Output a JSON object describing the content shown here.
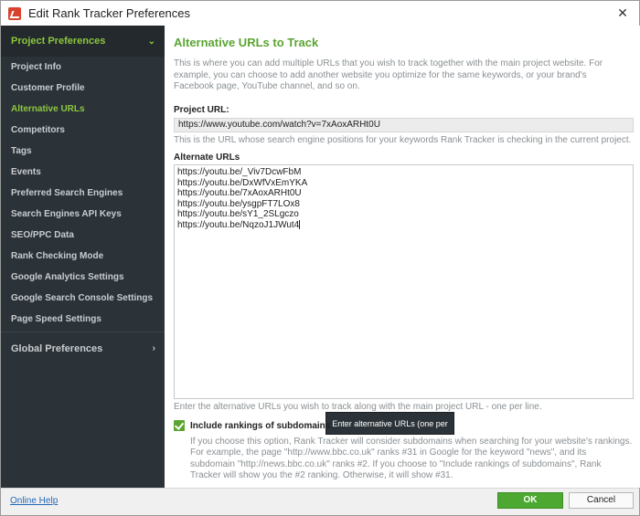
{
  "window": {
    "title": "Edit Rank Tracker Preferences",
    "close_icon": "close-icon",
    "app_icon": "rank-tracker-icon",
    "close_glyph": "✕"
  },
  "sidebar": {
    "project_section": "Project Preferences",
    "project_chevron": "⌄",
    "items": [
      {
        "label": "Project Info"
      },
      {
        "label": "Customer Profile"
      },
      {
        "label": "Alternative URLs"
      },
      {
        "label": "Competitors"
      },
      {
        "label": "Tags"
      },
      {
        "label": "Events"
      },
      {
        "label": "Preferred Search Engines"
      },
      {
        "label": "Search Engines API Keys"
      },
      {
        "label": "SEO/PPC Data"
      },
      {
        "label": "Rank Checking Mode"
      },
      {
        "label": "Google Analytics Settings"
      },
      {
        "label": "Google Search Console Settings"
      },
      {
        "label": "Page Speed Settings"
      }
    ],
    "selected_index": 2,
    "global_section": "Global Preferences",
    "global_chevron": "›"
  },
  "main": {
    "heading": "Alternative URLs to Track",
    "description": "This is where you can add multiple URLs that you wish to track together with the main project website. For example, you can choose to add another website you optimize for the same keywords, or your brand's Facebook page, YouTube channel, and so on.",
    "project_url_label": "Project URL:",
    "project_url_value": "https://www.youtube.com/watch?v=7xAoxARHt0U",
    "project_url_hint": "This is the URL whose search engine positions for your keywords Rank Tracker is checking in the current project.",
    "alternate_label": "Alternate URLs",
    "alternate_urls": [
      "https://youtu.be/_Viv7DcwFbM",
      "https://youtu.be/DxWfVxEmYKA",
      "https://youtu.be/7xAoxARHt0U",
      "https://youtu.be/ysgpFT7LOx8",
      "https://youtu.be/sY1_2SLgczo",
      "https://youtu.be/NqzoJ1JWut4"
    ],
    "tooltip": "Enter alternative URLs (one per line)",
    "alternate_hint": "Enter the alternative URLs you wish to track along with the main project URL - one per line.",
    "subdomains_checked": true,
    "subdomains_label": "Include rankings of subdomains",
    "subdomains_description": "If you choose this option, Rank Tracker will consider subdomains when searching for your website's rankings. For example, the page \"http://www.bbc.co.uk\" ranks #31 in Google for the keyword \"news\", and its subdomain \"http://news.bbc.co.uk\" ranks #2. If you choose to \"Include rankings of subdomains\", Rank Tracker will show you the #2 ranking. Otherwise, it will show #31."
  },
  "footer": {
    "help_link": "Online Help",
    "ok_label": "OK",
    "cancel_label": "Cancel"
  },
  "colors": {
    "accent_green": "#5aa532",
    "sidebar_bg": "#2c3338",
    "link_blue": "#2468b8"
  }
}
